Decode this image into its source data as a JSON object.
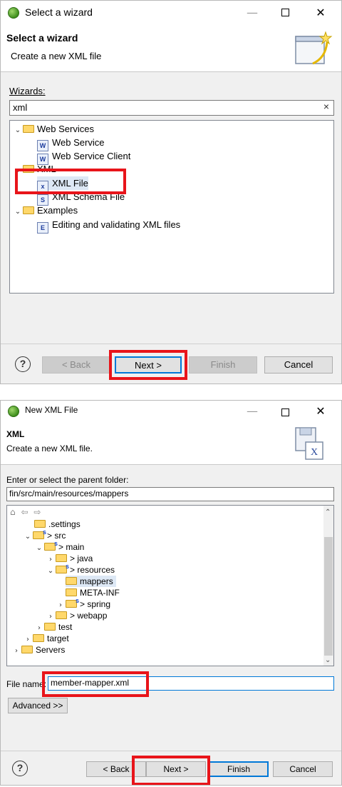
{
  "dialog1": {
    "title": "Select a wizard",
    "header_title": "Select a wizard",
    "header_desc": "Create a new XML file",
    "wizards_label": "Wizards:",
    "search_value": "xml",
    "clear_symbol": "×",
    "tree": [
      {
        "label": "Web Services",
        "icon": "folder-icon",
        "expanded": true
      },
      {
        "label": "Web Service",
        "icon": "web-service-icon"
      },
      {
        "label": "Web Service Client",
        "icon": "web-service-client-icon"
      },
      {
        "label": "XML",
        "icon": "folder-icon",
        "expanded": true
      },
      {
        "label": "XML File",
        "icon": "xml-file-icon"
      },
      {
        "label": "XML Schema File",
        "icon": "xml-schema-icon"
      },
      {
        "label": "Examples",
        "icon": "folder-icon",
        "expanded": true
      },
      {
        "label": "Editing and validating XML files",
        "icon": "example-icon"
      }
    ],
    "buttons": {
      "help": "?",
      "back": "< Back",
      "next": "Next >",
      "finish": "Finish",
      "cancel": "Cancel"
    }
  },
  "dialog2": {
    "title": "New XML File",
    "header_title": "XML",
    "header_desc": "Create a new XML file.",
    "folder_label": "Enter or select the parent folder:",
    "folder_value": "fin/src/main/resources/mappers",
    "tree": [
      {
        "label": ".settings",
        "icon": "folder-icon"
      },
      {
        "label": "> src",
        "icon": "source-folder-icon",
        "expanded": true
      },
      {
        "label": "> main",
        "icon": "source-folder-icon",
        "expanded": true
      },
      {
        "label": "> java",
        "icon": "folder-icon"
      },
      {
        "label": "> resources",
        "icon": "source-folder-icon",
        "expanded": true
      },
      {
        "label": "mappers",
        "icon": "folder-icon",
        "selected": true
      },
      {
        "label": "META-INF",
        "icon": "folder-icon"
      },
      {
        "label": "> spring",
        "icon": "source-folder-icon"
      },
      {
        "label": "> webapp",
        "icon": "folder-icon"
      },
      {
        "label": "test",
        "icon": "folder-icon"
      },
      {
        "label": "target",
        "icon": "folder-icon"
      },
      {
        "label": "Servers",
        "icon": "folder-icon"
      }
    ],
    "file_name_label": "File name:",
    "file_name_value": "member-mapper.xml",
    "advanced_label": "Advanced >>",
    "buttons": {
      "help": "?",
      "back": "< Back",
      "next": "Next >",
      "finish": "Finish",
      "cancel": "Cancel"
    }
  },
  "colors": {
    "highlight_box": "#e8141a",
    "default_button_border": "#0078d7"
  }
}
